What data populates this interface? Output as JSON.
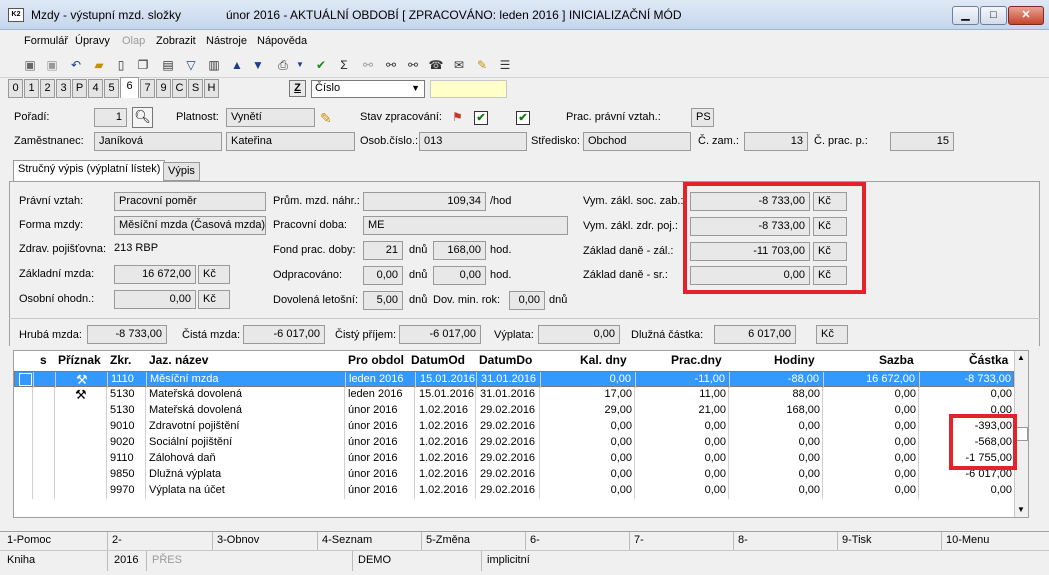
{
  "window": {
    "title": "Mzdy - výstupní mzd. složky",
    "period": "únor 2016 - AKTUÁLNÍ OBDOBÍ [ ZPRACOVÁNO: leden 2016 ]  INICIALIZAČNÍ MÓD",
    "min": "▁",
    "max": "□",
    "close": "✕"
  },
  "menu": [
    "Formulář",
    "Úpravy",
    "Olap",
    "Zobrazit",
    "Nástroje",
    "Nápověda"
  ],
  "tabs": [
    "0",
    "1",
    "2",
    "3",
    "P",
    "4",
    "5",
    "6",
    "7",
    "9",
    "C",
    "S",
    "H"
  ],
  "sort": {
    "z": "Z",
    "selected": "Číslo"
  },
  "header": {
    "poradi_label": "Pořadí:",
    "poradi": "1",
    "platnost_label": "Platnost:",
    "platnost": "Vynětí",
    "stav_label": "Stav zpracování:",
    "prac_vztah_label": "Prac. právní vztah.:",
    "prac_vztah": "PS",
    "zamestnanec_label": "Zaměstnanec:",
    "prijmeni": "Janíková",
    "jmeno": "Kateřina",
    "osob_label": "Osob.číslo.:",
    "osob": "013",
    "stredisko_label": "Středisko:",
    "stredisko": "Obchod",
    "czam_label": "Č. zam.:",
    "czam": "13",
    "cprac_label": "Č. prac. p.:",
    "cprac": "15"
  },
  "subtabs": [
    "Stručný výpis (výplatní lístek)",
    "Výpis"
  ],
  "form": {
    "pravni_vztah_label": "Právní vztah:",
    "pravni_vztah": "Pracovní poměr",
    "forma_label": "Forma mzdy:",
    "forma": "Měsíční mzda (Časová mzda)",
    "pojistovna_label": "Zdrav. pojišťovna:",
    "pojistovna": "213 RBP",
    "zakladni_label": "Základní mzda:",
    "zakladni": "16 672,00",
    "kc": "Kč",
    "osobni_label": "Osobní ohodn.:",
    "osobni": "0,00",
    "prum_label": "Prům. mzd. náhr.:",
    "prum": "109,34",
    "hod_unit": "/hod",
    "doba_label": "Pracovní doba:",
    "doba": "ME",
    "fond_label": "Fond prac. doby:",
    "fond_dny": "21",
    "dnu": "dnů",
    "fond_hod": "168,00",
    "hod": "hod.",
    "odprac_label": "Odpracováno:",
    "odprac_dny": "0,00",
    "odprac_hod": "0,00",
    "dovolena_label": "Dovolená letošní:",
    "dovolena": "5,00",
    "dov_min_label": "Dov. min. rok:",
    "dov_min": "0,00",
    "soc_label": "Vym. zákl. soc. zab.:",
    "soc": "-8 733,00",
    "zdr_label": "Vym. zákl. zdr. poj.:",
    "zdr": "-8 733,00",
    "dan_zal_label": "Základ daně - zál.:",
    "dan_zal": "-11 703,00",
    "dan_sr_label": "Základ daně - sr.:",
    "dan_sr": "0,00"
  },
  "totals": {
    "hruba_label": "Hrubá mzda:",
    "hruba": "-8 733,00",
    "cista_label": "Čistá mzda:",
    "cista": "-6 017,00",
    "prijem_label": "Čistý příjem:",
    "prijem": "-6 017,00",
    "vyplata_label": "Výplata:",
    "vyplata": "0,00",
    "dluzna_label": "Dlužná částka:",
    "dluzna": "6 017,00",
    "kc": "Kč"
  },
  "grid": {
    "headers": [
      "s",
      "Příznak",
      "Zkr.",
      "Jaz. název",
      "Pro obdol",
      "DatumOd",
      "DatumDo",
      "Kal. dny",
      "Prac.dny",
      "Hodiny",
      "Sazba",
      "Částka"
    ],
    "rows": [
      {
        "flag": "⚒",
        "zkr": "1110",
        "nazev": "Měsíční mzda",
        "obdobi": "leden 2016",
        "od": "15.01.2016",
        "do": "31.01.2016",
        "kal": "0,00",
        "prac": "-11,00",
        "hod": "-88,00",
        "sazba": "16 672,00",
        "castka": "-8 733,00"
      },
      {
        "flag": "⚒",
        "zkr": "5130",
        "nazev": "Mateřská dovolená",
        "obdobi": "leden 2016",
        "od": "15.01.2016",
        "do": "31.01.2016",
        "kal": "17,00",
        "prac": "11,00",
        "hod": "88,00",
        "sazba": "0,00",
        "castka": "0,00"
      },
      {
        "flag": "",
        "zkr": "5130",
        "nazev": "Mateřská dovolená",
        "obdobi": "únor 2016",
        "od": "1.02.2016",
        "do": "29.02.2016",
        "kal": "29,00",
        "prac": "21,00",
        "hod": "168,00",
        "sazba": "0,00",
        "castka": "0,00"
      },
      {
        "flag": "",
        "zkr": "9010",
        "nazev": "Zdravotní pojištění",
        "obdobi": "únor 2016",
        "od": "1.02.2016",
        "do": "29.02.2016",
        "kal": "0,00",
        "prac": "0,00",
        "hod": "0,00",
        "sazba": "0,00",
        "castka": "-393,00"
      },
      {
        "flag": "",
        "zkr": "9020",
        "nazev": "Sociální pojištění",
        "obdobi": "únor 2016",
        "od": "1.02.2016",
        "do": "29.02.2016",
        "kal": "0,00",
        "prac": "0,00",
        "hod": "0,00",
        "sazba": "0,00",
        "castka": "-568,00"
      },
      {
        "flag": "",
        "zkr": "9110",
        "nazev": "Zálohová daň",
        "obdobi": "únor 2016",
        "od": "1.02.2016",
        "do": "29.02.2016",
        "kal": "0,00",
        "prac": "0,00",
        "hod": "0,00",
        "sazba": "0,00",
        "castka": "-1 755,00"
      },
      {
        "flag": "",
        "zkr": "9850",
        "nazev": "Dlužná výplata",
        "obdobi": "únor 2016",
        "od": "1.02.2016",
        "do": "29.02.2016",
        "kal": "0,00",
        "prac": "0,00",
        "hod": "0,00",
        "sazba": "0,00",
        "castka": "-6 017,00"
      },
      {
        "flag": "",
        "zkr": "9970",
        "nazev": "Výplata na účet",
        "obdobi": "únor 2016",
        "od": "1.02.2016",
        "do": "29.02.2016",
        "kal": "0,00",
        "prac": "0,00",
        "hod": "0,00",
        "sazba": "0,00",
        "castka": "0,00"
      }
    ]
  },
  "fkeys": [
    "1-Pomoc",
    "2-",
    "3-Obnov",
    "4-Seznam",
    "5-Změna",
    "6-",
    "7-",
    "8-",
    "9-Tisk",
    "10-Menu"
  ],
  "status": {
    "kniha": "Kniha",
    "rok": "2016",
    "pres": "PŘES",
    "demo": "DEMO",
    "implicitni": "implicitní"
  }
}
